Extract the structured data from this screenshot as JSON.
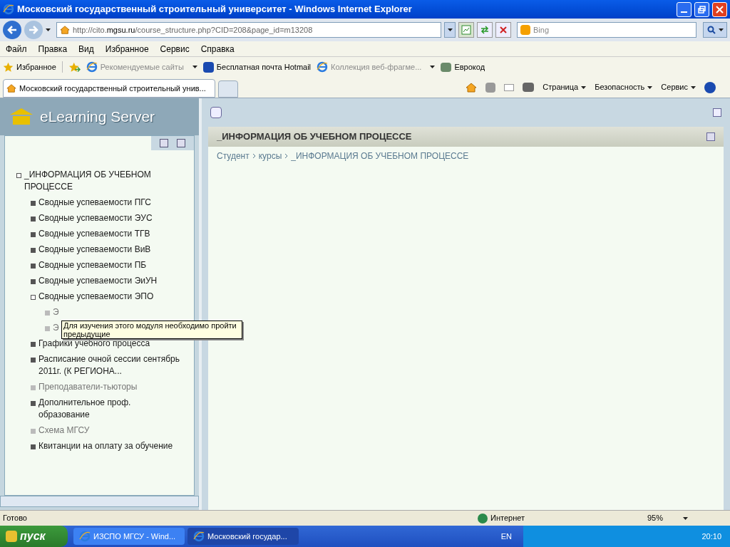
{
  "window": {
    "title": "Московский государственный строительный университет - Windows Internet Explorer"
  },
  "address": {
    "url_prefix": "http://cito.",
    "url_domain": "mgsu.ru",
    "url_rest": "/course_structure.php?CID=208&page_id=m13208"
  },
  "search": {
    "placeholder": "Bing"
  },
  "menu": [
    "Файл",
    "Правка",
    "Вид",
    "Избранное",
    "Сервис",
    "Справка"
  ],
  "favorites_bar": {
    "label": "Избранное",
    "links": [
      {
        "label": "Рекомендуемые сайты",
        "dimmed": true,
        "dropdown": true
      },
      {
        "label": "Бесплатная почта Hotmail",
        "dimmed": false,
        "dropdown": false
      },
      {
        "label": "Коллекция веб-фрагме...",
        "dimmed": true,
        "dropdown": true
      },
      {
        "label": "Еврокод",
        "dimmed": false,
        "dropdown": false
      }
    ]
  },
  "tabs": [
    {
      "label": "Московский государственный строительный унив...",
      "selected": true
    }
  ],
  "command_bar": [
    "Страница",
    "Безопасность",
    "Сервис"
  ],
  "sidebar": {
    "logo": "eLearning Server",
    "tree": [
      {
        "label": "_ИНФОРМАЦИЯ ОБ УЧЕБНОМ ПРОЦЕССЕ",
        "available": true,
        "expanded": true,
        "children": [
          {
            "label": "Сводные успеваемости ПГС",
            "available": true
          },
          {
            "label": "Сводные успеваемости ЭУС",
            "available": true
          },
          {
            "label": "Сводные успеваемости ТГВ",
            "available": true
          },
          {
            "label": "Сводные успеваемости ВиВ",
            "available": true
          },
          {
            "label": "Сводные успеваемости ПБ",
            "available": true
          },
          {
            "label": "Сводные успеваемости ЭиУН",
            "available": true
          },
          {
            "label": "Сводные успеваемости ЭПО",
            "available": true,
            "expanded": true,
            "children": [
              {
                "label": "Э",
                "available": false
              },
              {
                "label": "Э",
                "available": false
              }
            ]
          },
          {
            "label": "Графики учебного процесса",
            "available": true
          },
          {
            "label": "Расписание очной сессии сентябрь 2011г. (К РЕГИОНА...",
            "available": true
          },
          {
            "label": "Преподаватели-тьюторы",
            "available": false
          },
          {
            "label": "Дополнительное проф. образование",
            "available": true
          },
          {
            "label": "Схема МГСУ",
            "available": false
          },
          {
            "label": "Квитанции на оплату за обучение",
            "available": true
          }
        ]
      }
    ]
  },
  "tooltip": "Для изучения этого модуля необходимо пройти предыдущие",
  "content": {
    "title": "_ИНФОРМАЦИЯ ОБ УЧЕБНОМ ПРОЦЕССЕ",
    "breadcrumbs": [
      "Студент",
      "курсы",
      "_ИНФОРМАЦИЯ ОБ УЧЕБНОМ ПРОЦЕССЕ"
    ]
  },
  "status_bar": {
    "text": "Готово",
    "zone": "Интернет",
    "zoom": "95%"
  },
  "taskbar": {
    "start": "пуск",
    "windows": [
      {
        "label": "ИЗСПО МГСУ - Wind...",
        "selected": false
      },
      {
        "label": "Московский государ...",
        "selected": true
      }
    ],
    "language": "EN",
    "clock": "20:10"
  }
}
